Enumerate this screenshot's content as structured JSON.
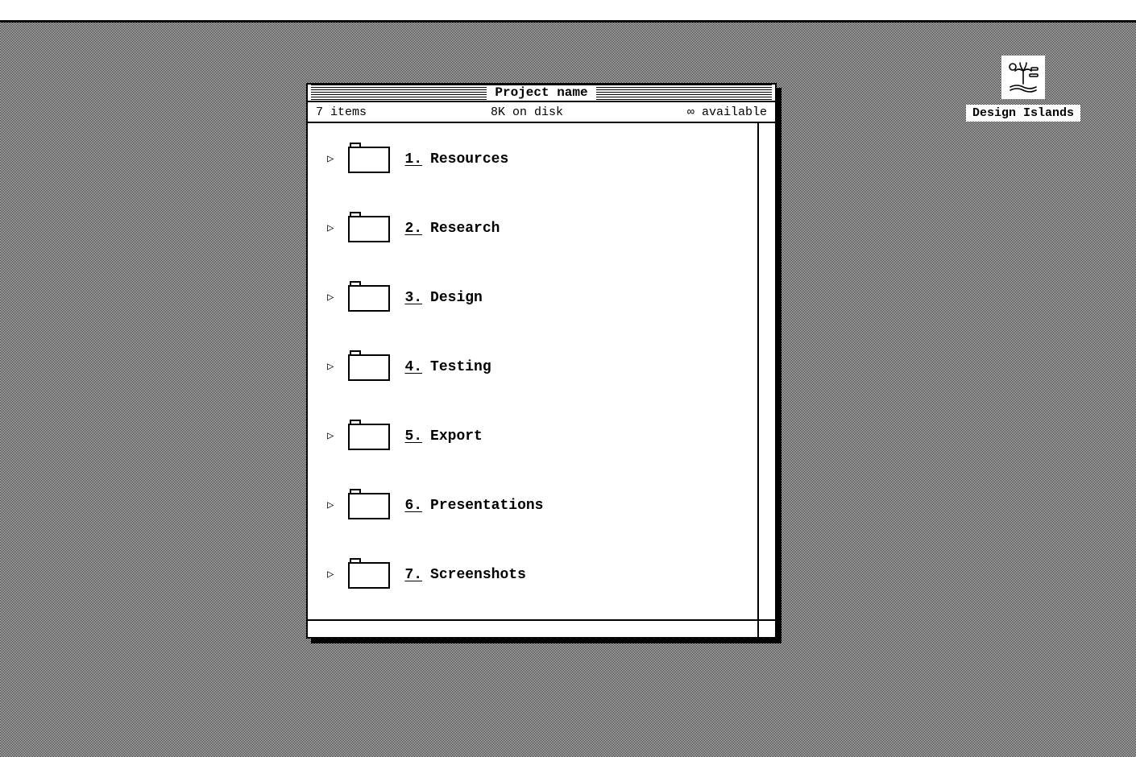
{
  "desktop": {
    "disk_label": "Design Islands"
  },
  "window": {
    "title": "Project name",
    "status": {
      "items": "7 items",
      "disk": "8K on disk",
      "avail": "∞ available"
    },
    "folders": [
      {
        "num": "1.",
        "name": "Resources"
      },
      {
        "num": "2.",
        "name": "Research"
      },
      {
        "num": "3.",
        "name": "Design"
      },
      {
        "num": "4.",
        "name": "Testing"
      },
      {
        "num": "5.",
        "name": "Export"
      },
      {
        "num": "6.",
        "name": "Presentations"
      },
      {
        "num": "7.",
        "name": "Screenshots"
      }
    ]
  }
}
